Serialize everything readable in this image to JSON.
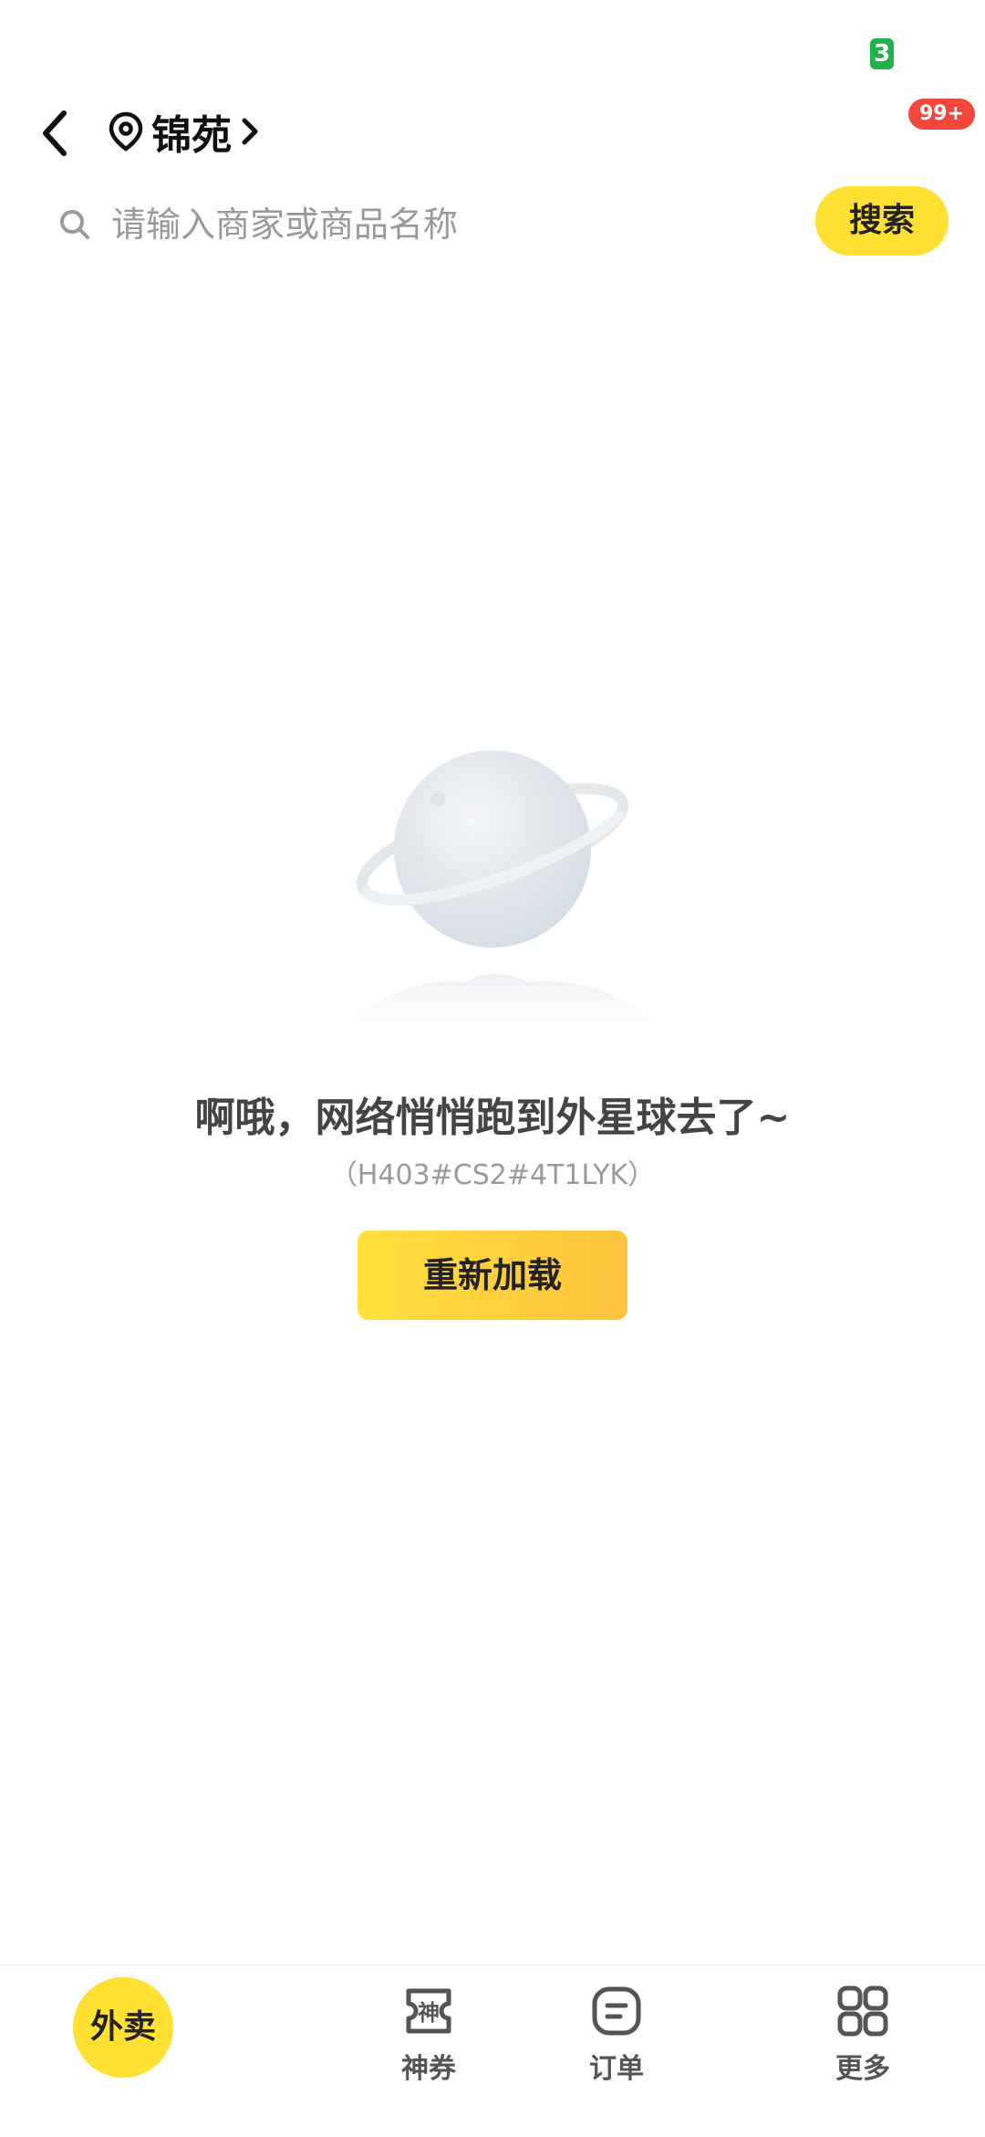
{
  "status_bar": {
    "badge": "3"
  },
  "header": {
    "location": "锦苑",
    "message_badge": "99+"
  },
  "search": {
    "placeholder": "请输入商家或商品名称",
    "value": "",
    "button_label": "搜索"
  },
  "error": {
    "title": "啊哦，网络悄悄跑到外星球去了~",
    "code": "（H403#CS2#4T1LYK）",
    "reload_label": "重新加载"
  },
  "bottom_nav": {
    "items": [
      {
        "label": "外卖",
        "icon": "takeout-icon"
      },
      {
        "label": "神券",
        "icon": "coupon-icon"
      },
      {
        "label": "订单",
        "icon": "order-icon"
      },
      {
        "label": "更多",
        "icon": "grid-icon"
      }
    ]
  },
  "colors": {
    "accent_yellow": "#ffe033",
    "badge_red": "#f2473d",
    "badge_green": "#22b14c"
  }
}
